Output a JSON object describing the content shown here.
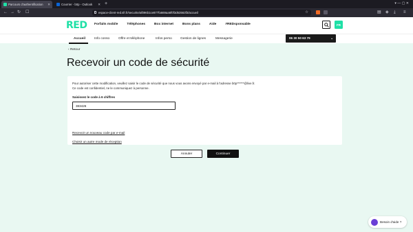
{
  "browser": {
    "tabs": [
      {
        "title": "Parcours d'authentification",
        "active": true,
        "favicon_color": "#1fe0a6"
      },
      {
        "title": "Courrier - b0p - Outlook",
        "active": false,
        "favicon_color": "#0a64d6"
      }
    ],
    "new_tab": "+",
    "url": "espace-client-red.sfr.fr/securite/af096b1ce877fa669aa6f0f3d63563f3/accueil",
    "tabbar_controls": "▾  —  ▢  ✕"
  },
  "header": {
    "logo": "RED",
    "brand_color": "#1fe0a6",
    "nav": [
      "Forfaits mobile",
      "Téléphones",
      "Box internet",
      "Bons plans",
      "Aide",
      "#REDsponsable"
    ],
    "lang": "FR"
  },
  "subnav": {
    "items": [
      "Accueil",
      "Info conso",
      "Offre et téléphone",
      "Infos perso",
      "Gestion de lignes",
      "Messagerie"
    ],
    "active": "Accueil",
    "line_number": "06 30 50 63 79"
  },
  "back_link": "Retour",
  "page_title": "Recevoir un code de sécurité",
  "form": {
    "description_line1": "Pour autoriser cette modification, veuillez saisir le code de sécurité que nous vous avons envoyé par e-mail à l'adresse b0p******@live.fr.",
    "description_line2": "Ce code est confidentiel, ne le communiquez à personne.",
    "code_label": "Saisissez le code à 6 chiffres",
    "code_value": "383426",
    "resend_link": "Recevoir un nouveau code par e-mail",
    "other_mode_link": "Choisir un autre mode de réception",
    "cancel_label": "Annuler",
    "continue_label": "Continuer"
  },
  "help_widget": {
    "label": "Besoin d'aide ?"
  }
}
